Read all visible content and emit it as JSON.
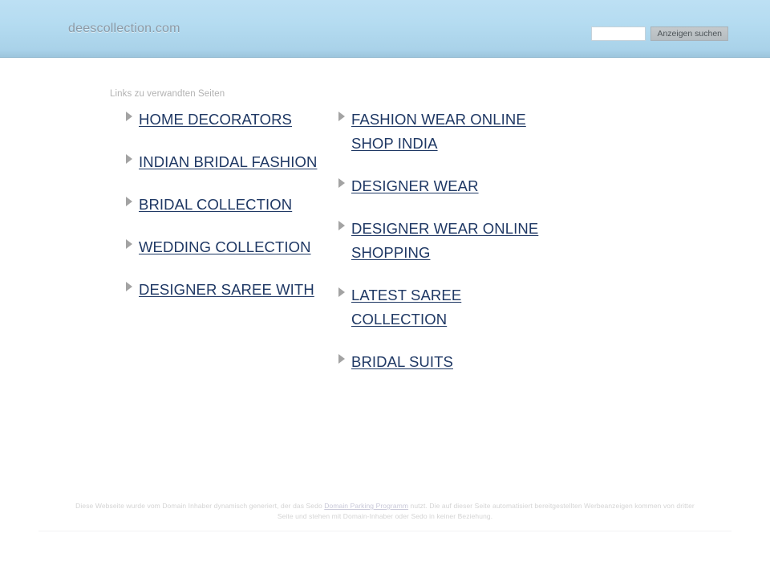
{
  "header": {
    "domain_title": "deescollection.com",
    "search": {
      "input_value": "",
      "input_placeholder": "",
      "button_label": "Anzeigen suchen"
    },
    "colors": {
      "gradient_top": "#bde0f4",
      "gradient_bottom": "#9cc5dd",
      "title_color": "#8c9aa6"
    }
  },
  "main": {
    "related_heading": "Links zu verwandten Seiten",
    "link_color": "#1f3864",
    "arrow_color": "#a3a3a3",
    "columns": {
      "left": [
        {
          "label": "HOME DECORATORS"
        },
        {
          "label": "INDIAN BRIDAL FASHION"
        },
        {
          "label": "BRIDAL COLLECTION"
        },
        {
          "label": "WEDDING COLLECTION"
        },
        {
          "label": "DESIGNER SAREE WITH"
        }
      ],
      "right": [
        {
          "label": "FASHION WEAR ONLINE SHOP INDIA"
        },
        {
          "label": "DESIGNER WEAR"
        },
        {
          "label": "DESIGNER WEAR ONLINE SHOPPING"
        },
        {
          "label": "LATEST SAREE COLLECTION"
        },
        {
          "label": "BRIDAL SUITS"
        }
      ]
    }
  },
  "footer": {
    "text_before_link": "Diese Webseite wurde vom Domain Inhaber dynamisch generiert, der das Sedo ",
    "link_label": "Domain Parking Programm",
    "text_after_link": " nutzt. Die auf dieser Seite automatisiert bereitgestellten Werbeanzeigen kommen von dritter Seite und stehen mit Domain-Inhaber oder Sedo in keiner Beziehung."
  }
}
